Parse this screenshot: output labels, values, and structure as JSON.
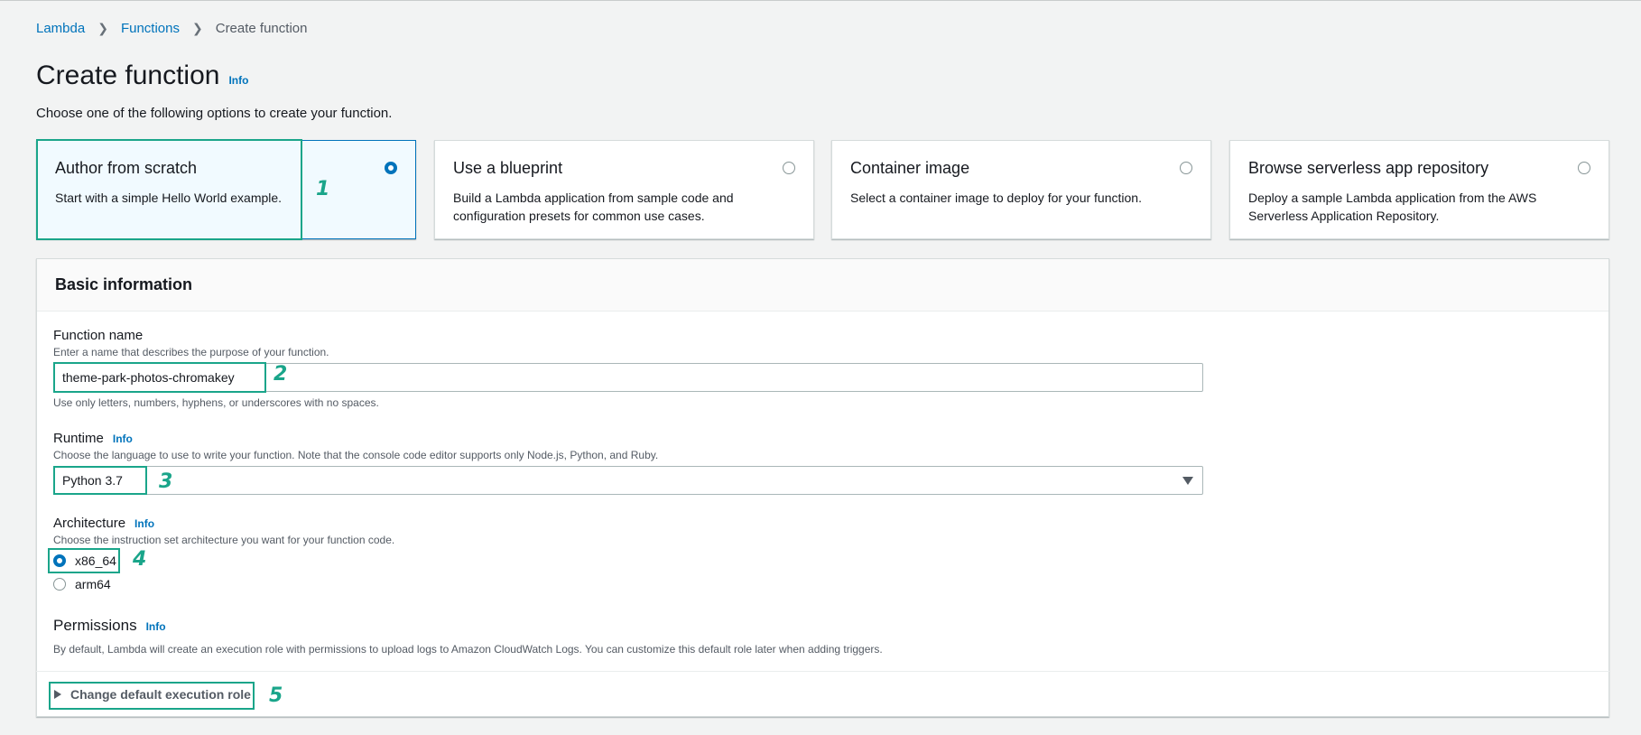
{
  "breadcrumb": {
    "items": [
      "Lambda",
      "Functions"
    ],
    "current": "Create function"
  },
  "header": {
    "title": "Create function",
    "info": "Info",
    "subtitle": "Choose one of the following options to create your function."
  },
  "options": [
    {
      "title": "Author from scratch",
      "desc": "Start with a simple Hello World example.",
      "selected": true
    },
    {
      "title": "Use a blueprint",
      "desc": "Build a Lambda application from sample code and configuration presets for common use cases.",
      "selected": false
    },
    {
      "title": "Container image",
      "desc": "Select a container image to deploy for your function.",
      "selected": false
    },
    {
      "title": "Browse serverless app repository",
      "desc": "Deploy a sample Lambda application from the AWS Serverless Application Repository.",
      "selected": false
    }
  ],
  "basic_info": {
    "heading": "Basic information",
    "function_name": {
      "label": "Function name",
      "desc": "Enter a name that describes the purpose of your function.",
      "value": "theme-park-photos-chromakey",
      "constraint": "Use only letters, numbers, hyphens, or underscores with no spaces."
    },
    "runtime": {
      "label": "Runtime",
      "info": "Info",
      "desc": "Choose the language to use to write your function. Note that the console code editor supports only Node.js, Python, and Ruby.",
      "value": "Python 3.7"
    },
    "architecture": {
      "label": "Architecture",
      "info": "Info",
      "desc": "Choose the instruction set architecture you want for your function code.",
      "options": [
        "x86_64",
        "arm64"
      ],
      "selected": "x86_64"
    },
    "permissions": {
      "label": "Permissions",
      "info": "Info",
      "desc": "By default, Lambda will create an execution role with permissions to upload logs to Amazon CloudWatch Logs. You can customize this default role later when adding triggers.",
      "expander": "Change default execution role"
    }
  },
  "annotations": [
    "1",
    "2",
    "3",
    "4",
    "5"
  ],
  "colors": {
    "accent": "#0073bb",
    "annotation": "#1aa58a"
  }
}
